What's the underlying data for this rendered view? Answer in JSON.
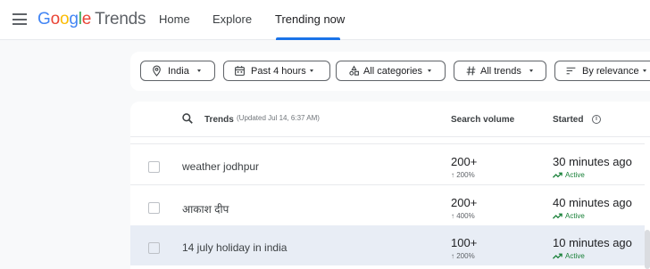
{
  "header": {
    "logo_google": [
      "G",
      "o",
      "o",
      "g",
      "l",
      "e"
    ],
    "logo_trends": "Trends",
    "tabs": [
      {
        "label": "Home"
      },
      {
        "label": "Explore"
      },
      {
        "label": "Trending now"
      }
    ],
    "menu_icon": "hamburger-menu-icon"
  },
  "colors": {
    "google_blue": "#4285f4",
    "google_red": "#ea4335",
    "google_yellow": "#fbbc05",
    "google_green": "#34a853",
    "accent": "#1a73e8",
    "active_green": "#188038",
    "row_highlight": "#e8edf5"
  },
  "filters": [
    {
      "label": "India",
      "icon": "location-pin-icon"
    },
    {
      "label": "Past 4 hours",
      "icon": "calendar-icon"
    },
    {
      "label": "All categories",
      "icon": "categories-icon"
    },
    {
      "label": "All trends",
      "icon": "hashtag-icon"
    },
    {
      "label": "By relevance",
      "icon": "sort-icon"
    }
  ],
  "table": {
    "header": {
      "trends": "Trends",
      "updated": "(Updated Jul 14, 6:37 AM)",
      "search_volume": "Search volume",
      "started": "Started",
      "info_glyph": "i"
    },
    "rows": [
      {
        "term": "weather jodhpur",
        "volume": "200+",
        "change": "200%",
        "started": "30 minutes ago",
        "status": "Active",
        "checked": false
      },
      {
        "term": "आकाश दीप",
        "volume": "200+",
        "change": "400%",
        "started": "40 minutes ago",
        "status": "Active",
        "checked": false
      },
      {
        "term": "14 july holiday in india",
        "volume": "100+",
        "change": "200%",
        "started": "10 minutes ago",
        "status": "Active",
        "checked": false
      }
    ]
  }
}
